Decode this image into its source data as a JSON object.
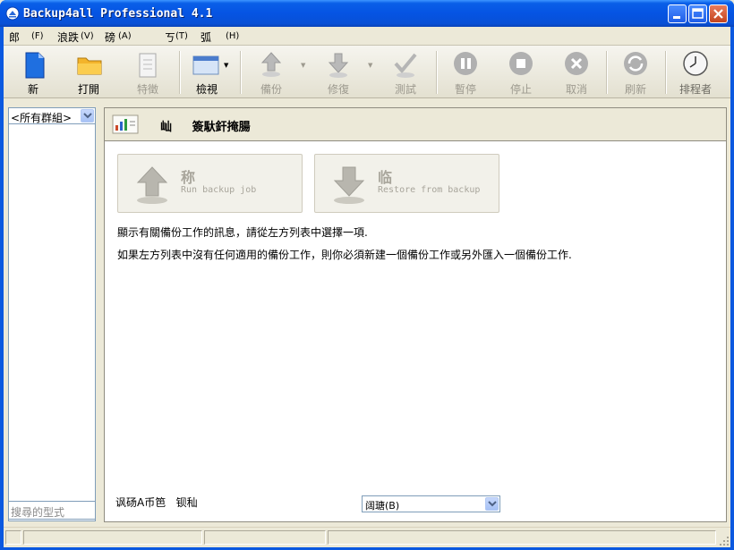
{
  "window": {
    "title": "Backup4all Professional 4.1"
  },
  "menu": {
    "items": [
      "郎",
      "(F)",
      "浪跌",
      "(V)",
      "磅",
      "(A)",
      "ㄎ",
      "(T)",
      "弧",
      "(H)"
    ]
  },
  "toolbar": {
    "buttons": [
      {
        "label": "新",
        "icon": "new-file-icon"
      },
      {
        "label": "打開",
        "icon": "open-folder-icon"
      },
      {
        "label": "特徵",
        "icon": "properties-icon"
      },
      {
        "label": "檢視",
        "icon": "view-icon"
      },
      {
        "label": "備份",
        "icon": "backup-arrow-icon"
      },
      {
        "label": "修復",
        "icon": "restore-arrow-icon"
      },
      {
        "label": "測試",
        "icon": "test-check-icon"
      },
      {
        "label": "暫停",
        "icon": "pause-icon"
      },
      {
        "label": "停止",
        "icon": "stop-icon"
      },
      {
        "label": "取消",
        "icon": "cancel-icon"
      },
      {
        "label": "刷新",
        "icon": "refresh-icon"
      },
      {
        "label": "排程者",
        "icon": "scheduler-clock-icon"
      }
    ]
  },
  "sidebar": {
    "group_select": "<所有群組>",
    "search_placeholder": "搜尋的型式"
  },
  "main": {
    "header_title_short": "屾",
    "header_title": "簽馱釬掩腸",
    "run_button": {
      "title": "称",
      "subtitle": "Run backup job"
    },
    "restore_button": {
      "title": "临",
      "subtitle": "Restore from backup"
    },
    "info_line1": "顯示有關備份工作的訊息，請從左方列表中選擇一項.",
    "info_line2": "如果左方列表中沒有任何適用的備份工作，則你必須新建一個備份工作或另外匯入一個備份工作.",
    "footer_label_1": "讽砀A币笆",
    "footer_label_2": "钡秈",
    "footer_select": "阔瑭(B)"
  },
  "colors": {
    "titlebar": "#0554e3",
    "window_bg": "#ece9d8",
    "disabled_text": "#9d9a8f"
  }
}
